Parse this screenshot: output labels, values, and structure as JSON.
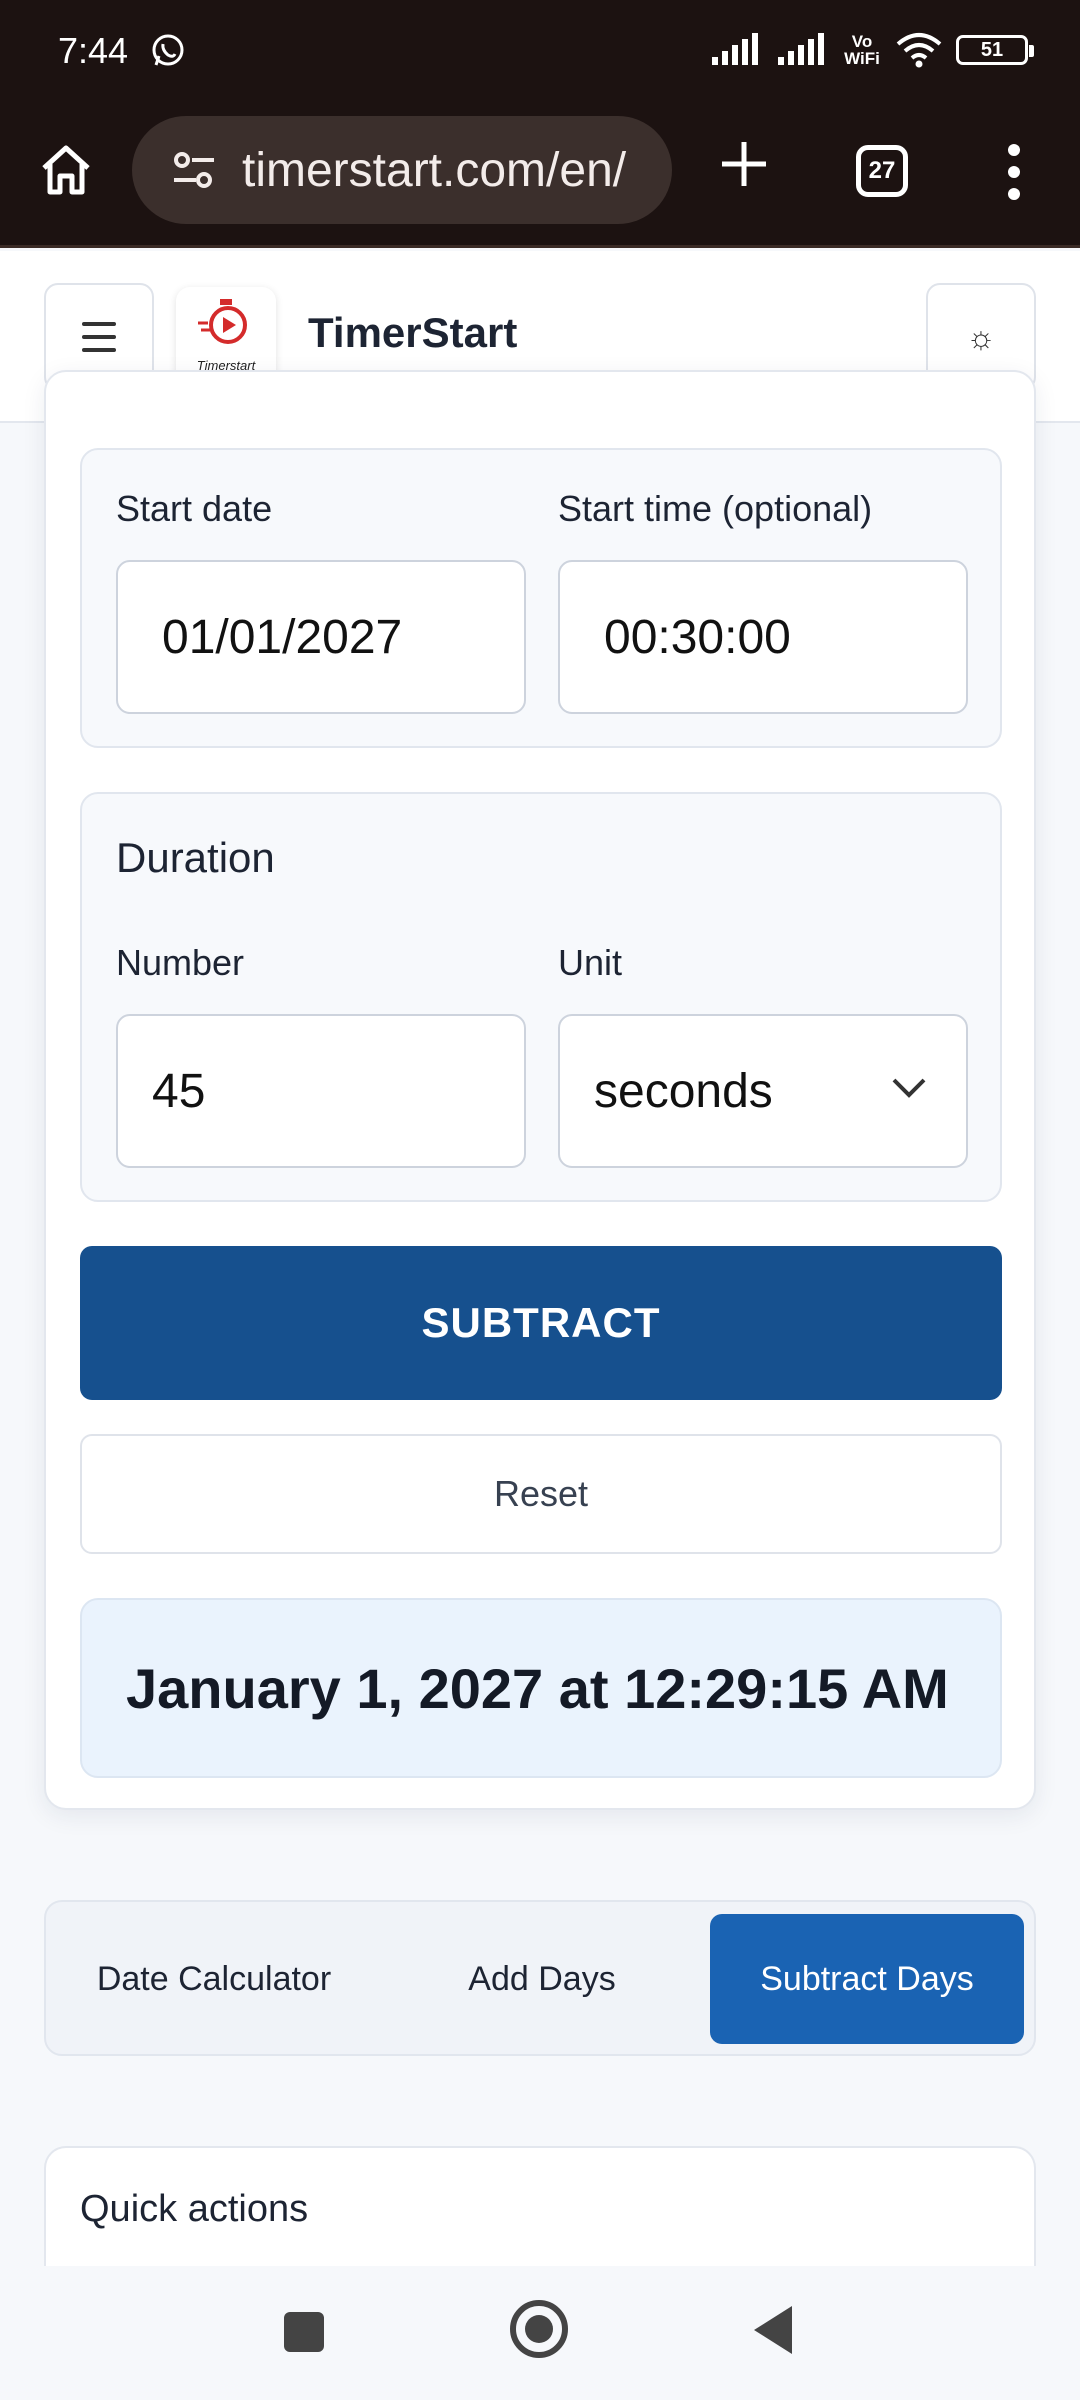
{
  "status_bar": {
    "time": "7:44",
    "network_label": "Vo\nWiFi",
    "battery": "51"
  },
  "browser": {
    "url": "timerstart.com/en/",
    "tabs_count": "27"
  },
  "app": {
    "brand": "TimerStart",
    "logo_text": "Timerstart",
    "theme_icon": "☼"
  },
  "form": {
    "start_date_label": "Start date",
    "start_date_value": "01/01/2027",
    "start_time_label": "Start time (optional)",
    "start_time_value": "00:30:00",
    "duration_title": "Duration",
    "number_label": "Number",
    "number_value": "45",
    "unit_label": "Unit",
    "unit_value": "seconds",
    "subtract_label": "SUBTRACT",
    "reset_label": "Reset",
    "result": "January 1, 2027 at 12:29:15 AM"
  },
  "tabs": [
    {
      "label": "Date Calculator",
      "active": false
    },
    {
      "label": "Add Days",
      "active": false
    },
    {
      "label": "Subtract Days",
      "active": true
    }
  ],
  "quick_actions": {
    "title": "Quick actions"
  },
  "colors": {
    "primary": "#16508e",
    "active_tab": "#1a63b3",
    "result_bg": "#eaf3fd",
    "brand_red": "#d42b2b"
  }
}
